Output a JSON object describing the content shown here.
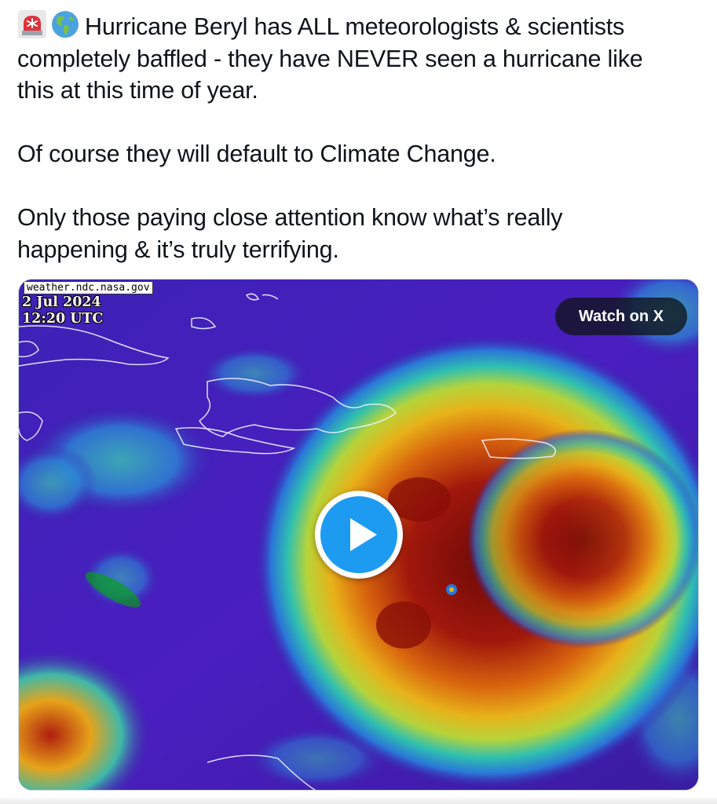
{
  "post": {
    "emojis": [
      "rotating-light-emoji",
      "globe-americas-emoji"
    ],
    "line1": "Hurricane Beryl has ALL meteorologists & scientists",
    "line2": "completely baffled - they have NEVER seen a hurricane like",
    "line3": "this at this time of year.",
    "paragraph2": "Of course they will default to Climate Change.",
    "paragraph3_line1": "Only those paying close attention know what’s really",
    "paragraph3_line2": "happening & it’s truly terrifying."
  },
  "media": {
    "source": "weather.ndc.nasa.gov",
    "date": "2 Jul 2024",
    "time": "12:20 UTC",
    "watch_label": "Watch on X",
    "play_icon": "play-icon"
  },
  "colors": {
    "accent": "#1d9bf0",
    "text": "#0f1419",
    "overlay": "#0f1419"
  }
}
